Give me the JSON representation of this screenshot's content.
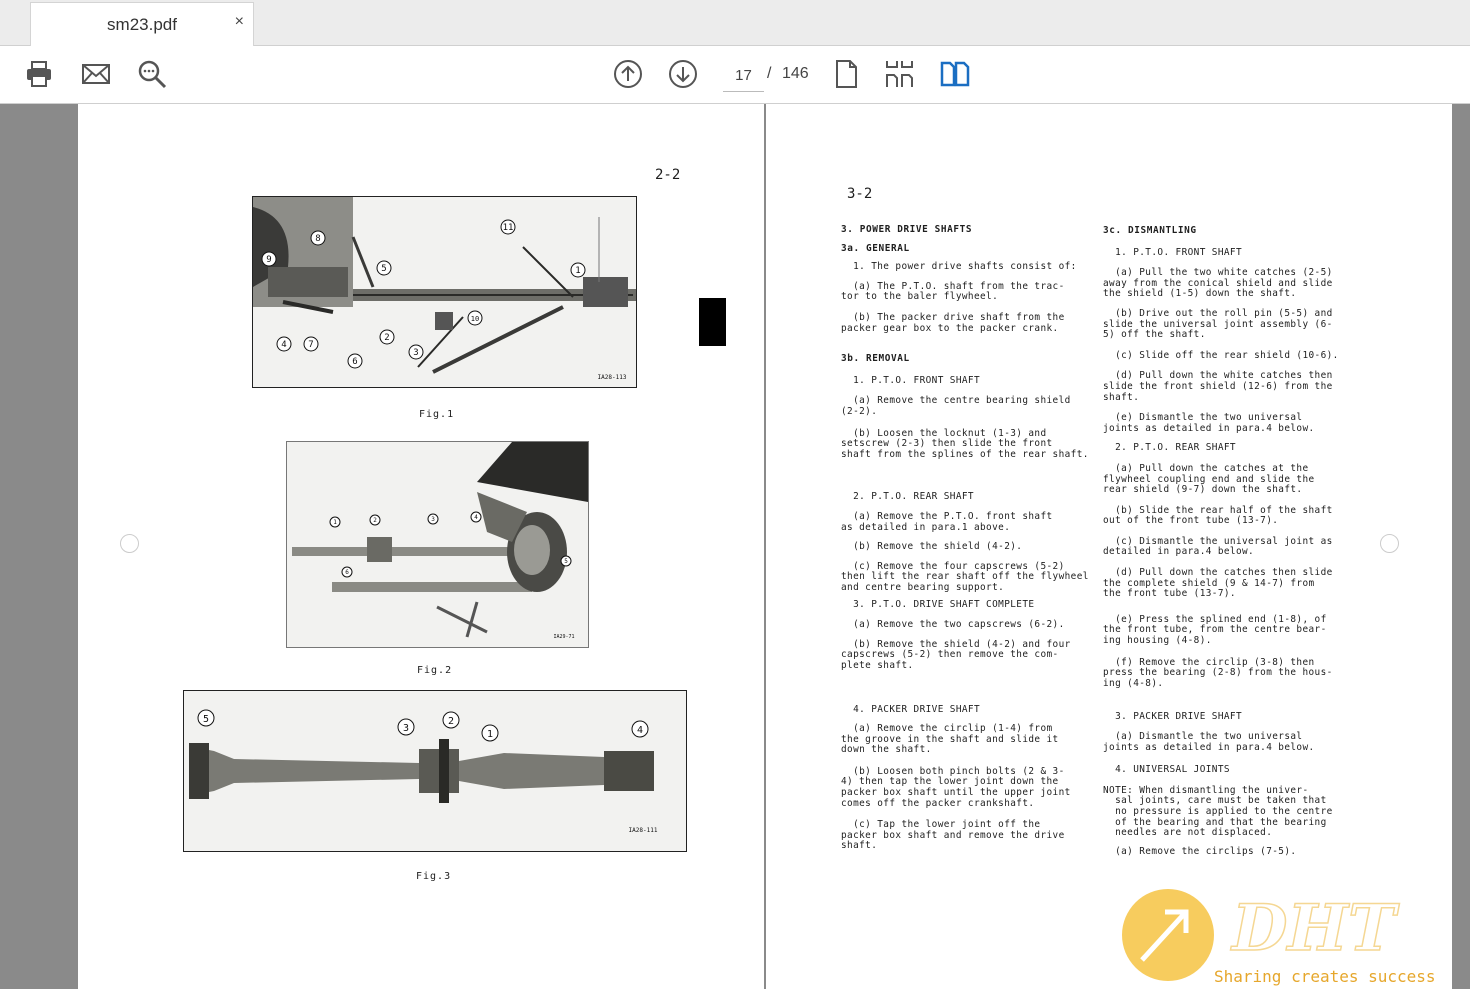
{
  "tab": {
    "title": "sm23.pdf",
    "close": "×"
  },
  "toolbar": {
    "page_current": "17",
    "page_sep": "/",
    "page_total": "146"
  },
  "left_page": {
    "page_number": "2-2",
    "figures": [
      {
        "caption": "Fig.1",
        "ref": "IA28-113",
        "callouts": [
          "11",
          "8",
          "9",
          "5",
          "1",
          "4",
          "7",
          "6",
          "2",
          "3",
          "10"
        ]
      },
      {
        "caption": "Fig.2",
        "ref": "IA29-71",
        "callouts": [
          "1",
          "2",
          "3",
          "4",
          "5",
          "6"
        ]
      },
      {
        "caption": "Fig.3",
        "ref": "IA28-111",
        "callouts": [
          "5",
          "3",
          "2",
          "1",
          "4"
        ]
      }
    ]
  },
  "right_page": {
    "page_number": "3-2",
    "col1": [
      {
        "h": true,
        "text": "3. POWER DRIVE SHAFTS"
      },
      {
        "h": true,
        "text": "3a. GENERAL"
      },
      {
        "text": "  1. The power drive shafts consist of:"
      },
      {
        "text": "  (a) The P.T.O. shaft from the trac-\ntor to the baler flywheel."
      },
      {
        "text": "  (b) The packer drive shaft from the\npacker gear box to the packer crank."
      },
      {
        "h": true,
        "text": "3b. REMOVAL"
      },
      {
        "text": "  1. P.T.O. FRONT SHAFT"
      },
      {
        "text": "  (a) Remove the centre bearing shield\n(2-2)."
      },
      {
        "text": "  (b) Loosen the locknut (1-3) and\nsetscrew (2-3) then slide the front\nshaft from the splines of the rear shaft."
      },
      {
        "text": "  2. P.T.O. REAR SHAFT"
      },
      {
        "text": "  (a) Remove the P.T.O. front shaft\nas detailed in para.1 above."
      },
      {
        "text": "  (b) Remove the shield (4-2)."
      },
      {
        "text": "  (c) Remove the four capscrews (5-2)\nthen lift the rear shaft off the flywheel\nand centre bearing support."
      },
      {
        "text": "  3. P.T.O. DRIVE SHAFT COMPLETE"
      },
      {
        "text": "  (a) Remove the two capscrews (6-2)."
      },
      {
        "text": "  (b) Remove the shield (4-2) and four\ncapscrews (5-2) then remove the com-\nplete shaft."
      },
      {
        "text": "  4. PACKER DRIVE SHAFT"
      },
      {
        "text": "  (a) Remove the circlip (1-4) from\nthe groove in the shaft and slide it\ndown the shaft."
      },
      {
        "text": "  (b) Loosen both pinch bolts (2 & 3-\n4) then tap the lower joint down the\npacker box shaft until the upper joint\ncomes off the packer crankshaft."
      },
      {
        "text": "  (c) Tap the lower joint off the\npacker box shaft and remove the drive\nshaft."
      }
    ],
    "col2": [
      {
        "h": true,
        "text": "3c. DISMANTLING"
      },
      {
        "text": "  1. P.T.O. FRONT SHAFT"
      },
      {
        "text": "  (a) Pull the two white catches (2-5)\naway from the conical shield and slide\nthe shield (1-5) down the shaft."
      },
      {
        "text": "  (b) Drive out the roll pin (5-5) and\nslide the universal joint assembly (6-\n5) off the shaft."
      },
      {
        "text": "  (c) Slide off the rear shield (10-6)."
      },
      {
        "text": "  (d) Pull down the white catches then\nslide the front shield (12-6) from the\nshaft."
      },
      {
        "text": "  (e) Dismantle the two universal\njoints as detailed in para.4 below."
      },
      {
        "text": "  2. P.T.O. REAR SHAFT"
      },
      {
        "text": "  (a) Pull down the catches at the\nflywheel coupling end and slide the\nrear shield (9-7) down the shaft."
      },
      {
        "text": "  (b) Slide the rear half of the shaft\nout of the front tube (13-7)."
      },
      {
        "text": "  (c) Dismantle the universal joint as\ndetailed in para.4 below."
      },
      {
        "text": "  (d) Pull down the catches then slide\nthe complete shield (9 & 14-7) from\nthe front tube (13-7)."
      },
      {
        "text": "  (e) Press the splined end (1-8), of\nthe front tube, from the centre bear-\ning housing (4-8)."
      },
      {
        "text": "  (f) Remove the circlip (3-8) then\npress the bearing (2-8) from the hous-\ning (4-8)."
      },
      {
        "text": "  3. PACKER DRIVE SHAFT"
      },
      {
        "text": "  (a) Dismantle the two universal\njoints as detailed in para.4 below."
      },
      {
        "text": "  4. UNIVERSAL JOINTS"
      },
      {
        "text": "NOTE: When dismantling the univer-\n  sal joints, care must be taken that\n  no pressure is applied to the centre\n  of the bearing and that the bearing\n  needles are not displaced."
      },
      {
        "text": "  (a) Remove the circlips (7-5)."
      }
    ]
  },
  "watermark": {
    "logo": "DHT",
    "tagline": "Sharing creates success"
  }
}
